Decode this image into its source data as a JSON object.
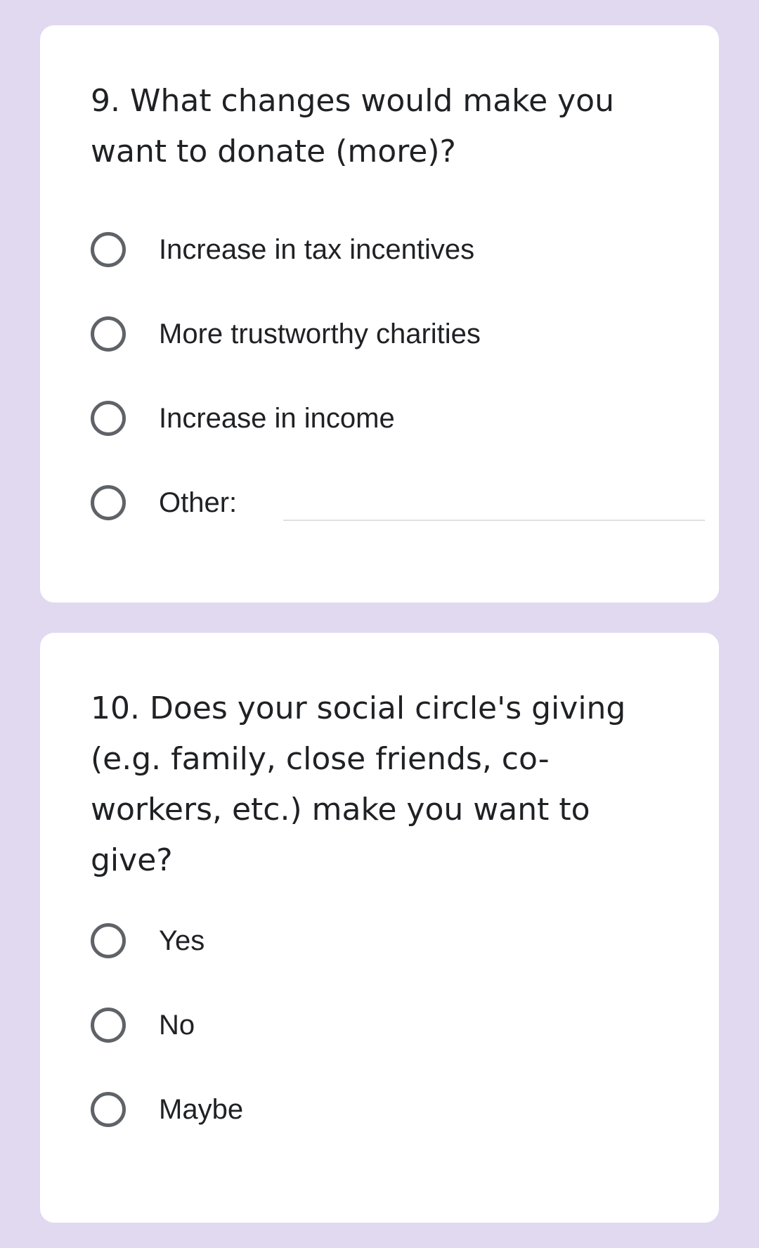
{
  "questions": [
    {
      "title": "9. What changes would make you want to donate (more)?",
      "options": [
        "Increase in tax incentives",
        "More trustworthy charities",
        "Increase in income"
      ],
      "other_label": "Other:",
      "other_value": ""
    },
    {
      "title": "10. Does your social circle's giving (e.g. family, close friends, co-workers, etc.) make you want to give?",
      "options": [
        "Yes",
        "No",
        "Maybe"
      ]
    }
  ],
  "colors": {
    "background": "#e1d9f0",
    "card": "#ffffff",
    "text": "#202124",
    "radio_border": "#5f6368",
    "input_underline": "#e0e0e0"
  },
  "icons": {
    "radio": "radio-unchecked-icon"
  }
}
